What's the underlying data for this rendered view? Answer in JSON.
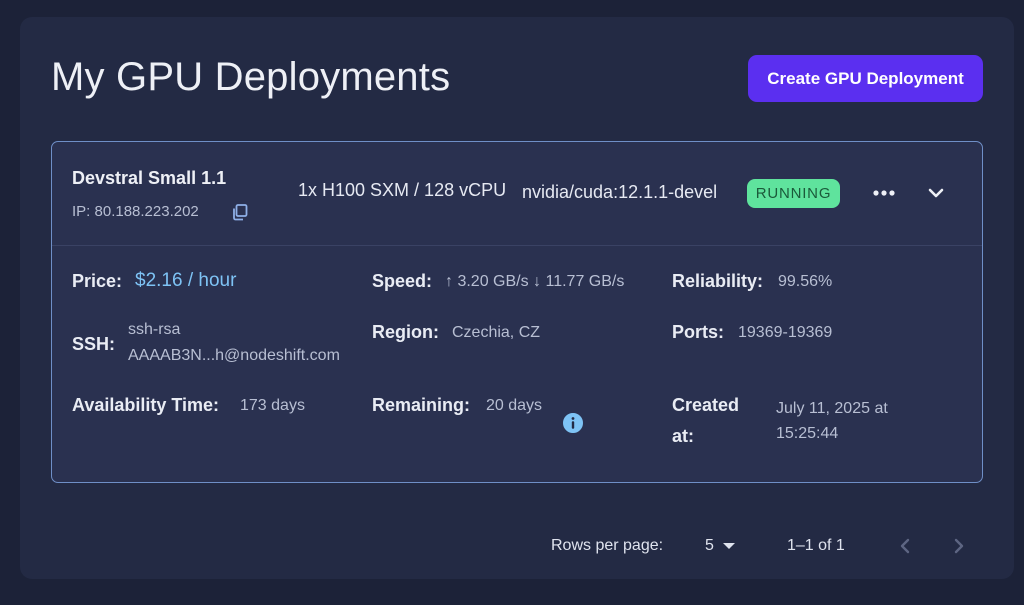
{
  "page": {
    "title": "My GPU Deployments",
    "create_button": "Create GPU Deployment"
  },
  "deployment": {
    "name": "Devstral Small 1.1",
    "ip": "IP: 80.188.223.202",
    "gpu": "1x H100 SXM / 128 vCPU",
    "image": "nvidia/cuda:12.1.1-devel",
    "status": "RUNNING",
    "status_color": "#5fe39d",
    "icons": {
      "copy": "copy-icon",
      "more": "more-horizontal-icon",
      "expand": "chevron-down-icon",
      "info": "info-icon"
    },
    "details": {
      "price_label": "Price:",
      "price_value": "$2.16 / hour",
      "speed_label": "Speed:",
      "speed_value": "↑ 3.20 GB/s ↓ 11.77 GB/s",
      "reliability_label": "Reliability:",
      "reliability_value": "99.56%",
      "ssh_label": "SSH:",
      "ssh_value_line1": "ssh-rsa",
      "ssh_value_line2": "AAAAB3N...h@nodeshift.com",
      "region_label": "Region:",
      "region_value": "Czechia, CZ",
      "ports_label": "Ports:",
      "ports_value": "19369-19369",
      "availability_label": "Availability Time:",
      "availability_value": "173 days",
      "remaining_label": "Remaining:",
      "remaining_value": "20 days",
      "created_label_line1": "Created",
      "created_label_line2": "at:",
      "created_value_line1": "July 11, 2025 at",
      "created_value_line2": "15:25:44"
    }
  },
  "pagination": {
    "rows_label": "Rows per page:",
    "rows_value": "5",
    "range": "1–1 of 1",
    "prev_icon": "chevron-left-icon",
    "next_icon": "chevron-right-icon"
  },
  "colors": {
    "background": "#1c2238",
    "panel": "#232a44",
    "accent": "#5b2ff0",
    "price": "#7ec3f5",
    "card_border": "#6f8fc7"
  }
}
